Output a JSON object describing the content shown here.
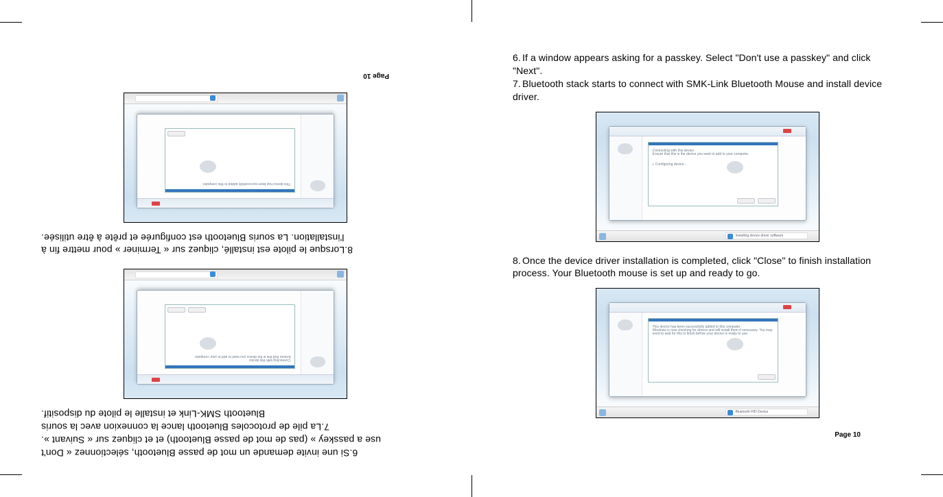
{
  "right_page": {
    "item6": "If a window appears asking for a passkey. Select \"Don't use a passkey\" and click \"Next\".",
    "item7": "Bluetooth stack starts to connect with SMK-Link Bluetooth Mouse and install  device driver.",
    "item8": "Once the device driver installation is completed, click \"Close\" to finish installation process. Your Bluetooth mouse is set up and ready to go.",
    "page_num": "Page  10"
  },
  "left_page": {
    "item6_a": "Si une invite demande un mot de passe Bluetooth, sélectionnez « Don't",
    "item6_b": "use a passkey » (pas de mot de passe Bluetooth) et et cliquez sur « Suivant ».",
    "item7_a": "La pile de protocoles Bluetooth lance la connexion avec la souris",
    "item7_b": "Bluetooth SMK-Link et installe le pilote du dispositif.",
    "item8_a": "Lorsque le pilote est installé, cliquez sur « Terminer » pour mettre fin à",
    "item8_b": "l'installation. La souris Bluetooth est configurée et prête à être utilisée.",
    "page_num": "Page  10"
  }
}
